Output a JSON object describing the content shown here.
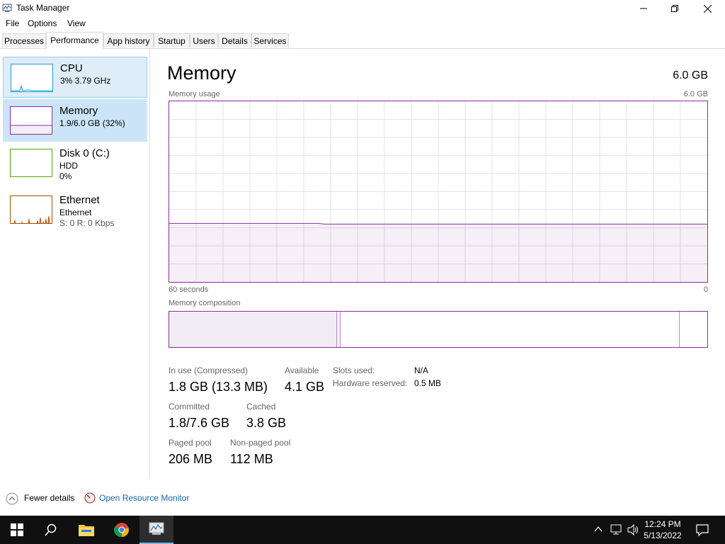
{
  "window": {
    "title": "Task Manager",
    "icon": "task-manager-icon"
  },
  "menu": [
    "File",
    "Options",
    "View"
  ],
  "tabs": [
    "Processes",
    "Performance",
    "App history",
    "Startup",
    "Users",
    "Details",
    "Services"
  ],
  "active_tab": "Performance",
  "sidebar": {
    "items": [
      {
        "name": "CPU",
        "line1": "3% 3.79 GHz",
        "line2": ""
      },
      {
        "name": "Memory",
        "line1": "1.9/6.0 GB (32%)",
        "line2": ""
      },
      {
        "name": "Disk 0 (C:)",
        "line1": "HDD",
        "line2": "0%"
      },
      {
        "name": "Ethernet",
        "line1": "Ethernet",
        "line2": "S: 0 R: 0 Kbps"
      }
    ],
    "selected": "Memory",
    "colors": {
      "cpu": "#1a9fd6",
      "memory": "#8b2d9e",
      "disk": "#4da60c",
      "ethernet": "#a74f01"
    }
  },
  "main": {
    "title": "Memory",
    "total": "6.0 GB",
    "usage_label": "Memory usage",
    "usage_max": "6.0 GB",
    "time_left": "60 seconds",
    "time_right": "0",
    "composition_label": "Memory composition",
    "usage_fraction": 0.32,
    "stats": {
      "in_use_label": "In use (Compressed)",
      "in_use_value": "1.8 GB (13.3 MB)",
      "available_label": "Available",
      "available_value": "4.1 GB",
      "committed_label": "Committed",
      "committed_value": "1.8/7.6 GB",
      "cached_label": "Cached",
      "cached_value": "3.8 GB",
      "paged_label": "Paged pool",
      "paged_value": "206 MB",
      "nonpaged_label": "Non-paged pool",
      "nonpaged_value": "112 MB"
    },
    "details": {
      "slots_label": "Slots used:",
      "slots_value": "N/A",
      "hw_label": "Hardware reserved:",
      "hw_value": "0.5 MB"
    }
  },
  "footer": {
    "fewer_details": "Fewer details",
    "open_monitor": "Open Resource Monitor"
  },
  "taskbar": {
    "time": "12:24 PM",
    "date": "5/13/2022"
  }
}
